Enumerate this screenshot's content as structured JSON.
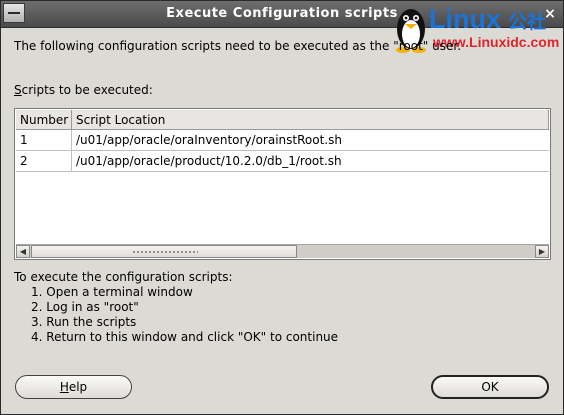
{
  "window": {
    "title": "Execute Configuration scripts",
    "close_glyph": "×"
  },
  "watermark": {
    "brand": "Linux",
    "brand_suffix": "公社",
    "url": "www.Linuxidc.com",
    "icon": "tux-penguin-icon"
  },
  "intro_text": "The following configuration scripts need to be executed as the \"root\" user.",
  "scripts_label_first": "S",
  "scripts_label_rest": "cripts to be executed:",
  "table": {
    "columns": [
      "Number",
      "Script Location"
    ],
    "rows": [
      {
        "number": "1",
        "location": "/u01/app/oracle/oraInventory/orainstRoot.sh"
      },
      {
        "number": "2",
        "location": "/u01/app/oracle/product/10.2.0/db_1/root.sh"
      }
    ],
    "scroll_left_glyph": "◀",
    "scroll_right_glyph": "▶"
  },
  "instructions": {
    "heading": "To execute the configuration scripts:",
    "steps": [
      "1. Open a terminal window",
      "2. Log in as \"root\"",
      "3. Run the scripts",
      "4. Return to this window and click \"OK\" to continue"
    ]
  },
  "buttons": {
    "help_first": "H",
    "help_rest": "elp",
    "ok": "OK"
  },
  "colors": {
    "titlebar": "#5a5a5a",
    "dialog_bg": "#dcdad5",
    "watermark_blue": "#1a73d9",
    "watermark_red": "#e0242b"
  }
}
